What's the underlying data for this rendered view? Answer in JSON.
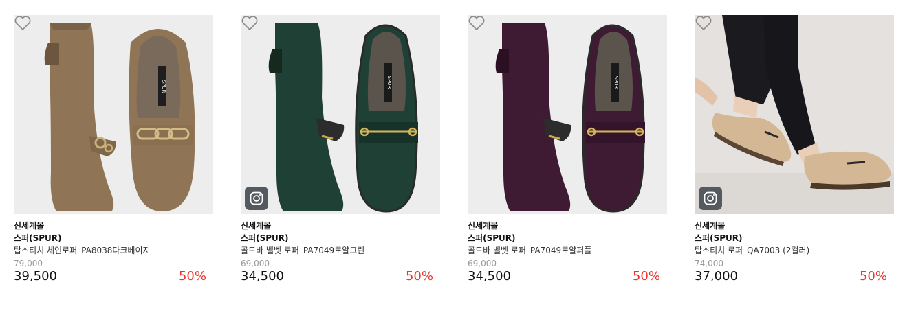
{
  "products": [
    {
      "mall": "신세계몰",
      "brand": "스퍼(SPUR)",
      "name": "탑스티치 체인로퍼_PA8038다크베이지",
      "original_price": "79,000",
      "price": "39,500",
      "discount": "50%",
      "color": "#8f7556",
      "has_instagram": false,
      "image": "shoe-pair-beige"
    },
    {
      "mall": "신세계몰",
      "brand": "스퍼(SPUR)",
      "name": "골드바 벨벳 로퍼_PA7049로얄그린",
      "original_price": "69,000",
      "price": "34,500",
      "discount": "50%",
      "color": "#1f4035",
      "has_instagram": true,
      "image": "shoe-pair-green"
    },
    {
      "mall": "신세계몰",
      "brand": "스퍼(SPUR)",
      "name": "골드바 벨벳 로퍼_PA7049로얄퍼플",
      "original_price": "69,000",
      "price": "34,500",
      "discount": "50%",
      "color": "#3e1a33",
      "has_instagram": false,
      "image": "shoe-pair-purple"
    },
    {
      "mall": "신세계몰",
      "brand": "스퍼(SPUR)",
      "name": "탑스티치 로퍼_QA7003 (2컬러)",
      "original_price": "74,000",
      "price": "37,000",
      "discount": "50%",
      "color": "#d4b896",
      "has_instagram": true,
      "image": "model-wearing-loafers"
    }
  ],
  "insole_logo": "SPUR",
  "icons": {
    "wishlist": "heart-outline-icon",
    "instagram": "instagram-icon"
  }
}
